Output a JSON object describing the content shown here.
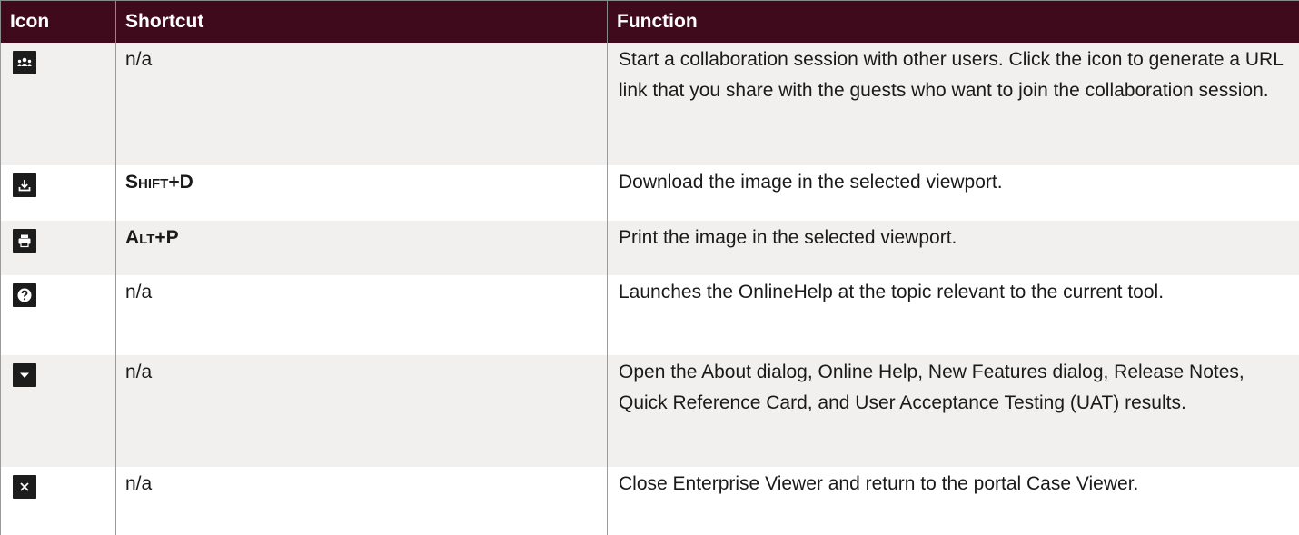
{
  "header": {
    "icon": "Icon",
    "shortcut": "Shortcut",
    "function": "Function"
  },
  "rows": [
    {
      "icon": "collaboration-icon",
      "shortcut": "n/a",
      "function": "Start a collaboration session with other users. Click the icon to generate a URL link that you share with the guests who want to join the collaboration session."
    },
    {
      "icon": "download-icon",
      "shortcut_first": "S",
      "shortcut_smallcaps": "HIFT",
      "shortcut_rest": "+D",
      "function": "Download the image in the selected viewport."
    },
    {
      "icon": "print-icon",
      "shortcut_first": "A",
      "shortcut_smallcaps": "LT",
      "shortcut_rest": "+P",
      "function": "Print the image in the selected viewport."
    },
    {
      "icon": "help-icon",
      "shortcut": "n/a",
      "function": "Launches the OnlineHelp at the topic relevant to the current tool."
    },
    {
      "icon": "dropdown-arrow-icon",
      "shortcut": "n/a",
      "function": "Open the About dialog, Online Help, New Features dialog, Release Notes, Quick Reference Card, and User Acceptance Testing (UAT) results."
    },
    {
      "icon": "close-icon",
      "shortcut": "n/a",
      "function": "Close Enterprise Viewer and return to the portal Case Viewer."
    }
  ],
  "colors": {
    "header_bg": "#3e0a1c",
    "row_shade": "#f1f0ee",
    "icon_bg": "#1c1c1c"
  }
}
